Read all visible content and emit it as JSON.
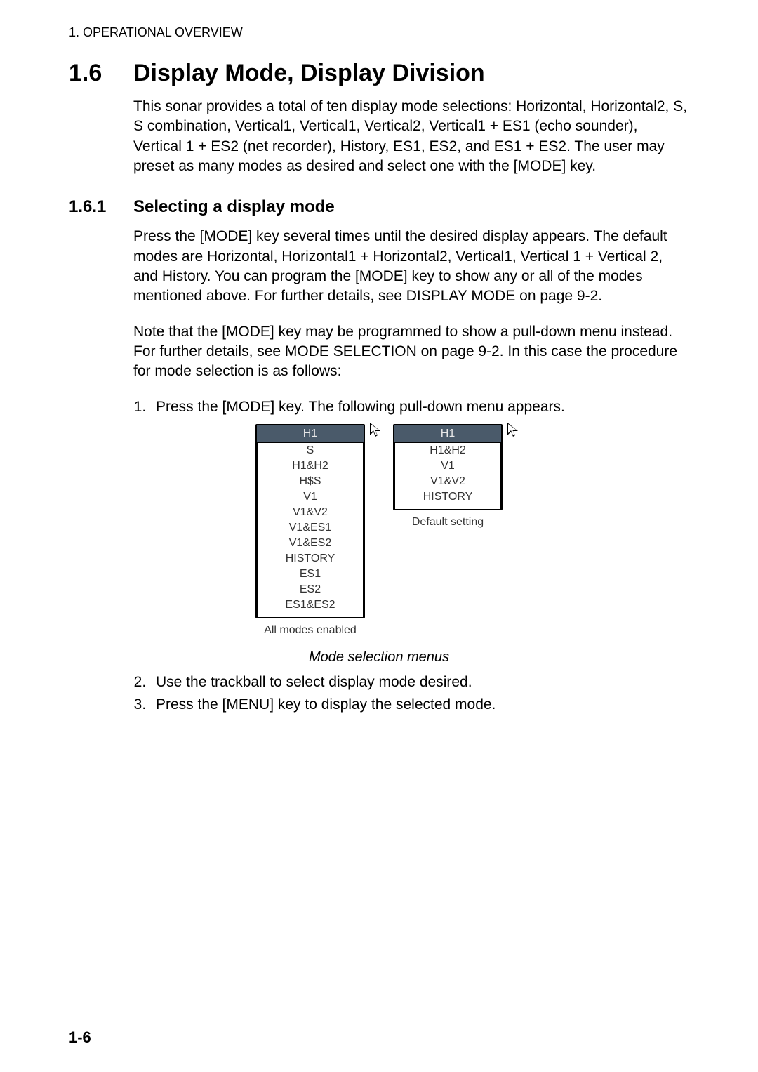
{
  "header": "1. OPERATIONAL OVERVIEW",
  "section": {
    "num": "1.6",
    "title": "Display Mode, Display Division",
    "intro": "This sonar provides a total of ten display mode selections: Horizontal, Horizontal2, S, S combination, Vertical1, Vertical1, Vertical2, Vertical1 + ES1 (echo sounder), Vertical 1 + ES2 (net recorder), History, ES1, ES2, and ES1 + ES2. The user may preset as many modes as desired and select one with the [MODE] key."
  },
  "subsection": {
    "num": "1.6.1",
    "title": "Selecting a display mode",
    "para1": "Press the [MODE] key several times until the desired display appears. The default modes are Horizontal, Horizontal1 + Horizontal2, Vertical1, Vertical 1 + Vertical 2, and History. You can program the [MODE] key to show any or all of the modes mentioned above. For further details, see DISPLAY MODE on page 9-2.",
    "para2": "Note that the [MODE] key may be programmed to show a pull-down menu instead. For further details, see MODE SELECTION on page 9-2. In this case the procedure for mode selection is as follows:",
    "step1": "Press the [MODE] key. The following pull-down menu appears.",
    "step2": "Use the trackball to select display mode desired.",
    "step3": "Press the [MENU] key to display the selected mode."
  },
  "figure": {
    "left_menu": {
      "header": "H1",
      "items": [
        "S",
        "H1&H2",
        "H$S",
        "V1",
        "V1&V2",
        "V1&ES1",
        "V1&ES2",
        "HISTORY",
        "ES1",
        "ES2",
        "ES1&ES2"
      ],
      "caption": "All modes enabled"
    },
    "right_menu": {
      "header": "H1",
      "items": [
        "H1&H2",
        "V1",
        "V1&V2",
        "HISTORY"
      ],
      "caption": "Default setting"
    },
    "main_caption": "Mode selection menus"
  },
  "page_number": "1-6"
}
